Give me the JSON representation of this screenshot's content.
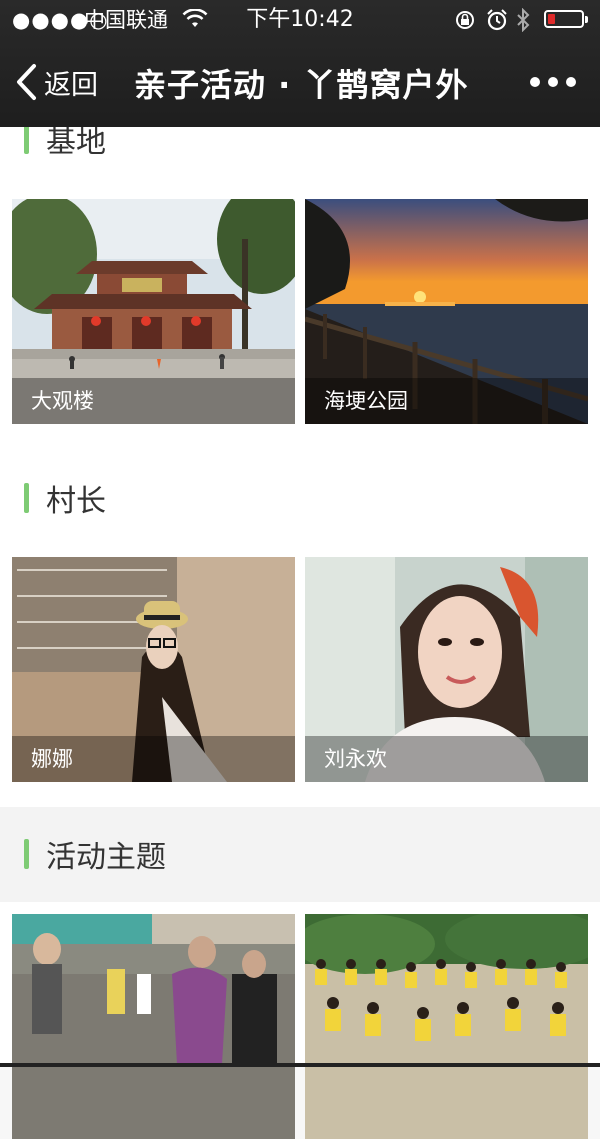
{
  "status_bar": {
    "signal": "●●●●○",
    "carrier": "中国联通",
    "time": "下午10:42",
    "battery_color": "#e02b2b"
  },
  "nav": {
    "back_label": "返回",
    "title": "亲子活动 · 丫鹊窝户外"
  },
  "sections": {
    "base": {
      "title": "基地",
      "items": [
        {
          "caption": "大观楼",
          "image": "pavilion-photo"
        },
        {
          "caption": "海埂公园",
          "image": "sunset-lake-photo"
        }
      ]
    },
    "village_head": {
      "title": "村长",
      "items": [
        {
          "caption": "娜娜",
          "image": "woman-hat-photo"
        },
        {
          "caption": "刘永欢",
          "image": "woman-portrait-photo"
        }
      ]
    },
    "activity_theme": {
      "title": "活动主题",
      "items": [
        {
          "caption": "",
          "image": "parents-children-photo"
        },
        {
          "caption": "",
          "image": "kids-yellow-shirts-photo"
        }
      ]
    }
  },
  "colors": {
    "accent_bar": "#7ecb74",
    "nav_bg": "#232323"
  }
}
